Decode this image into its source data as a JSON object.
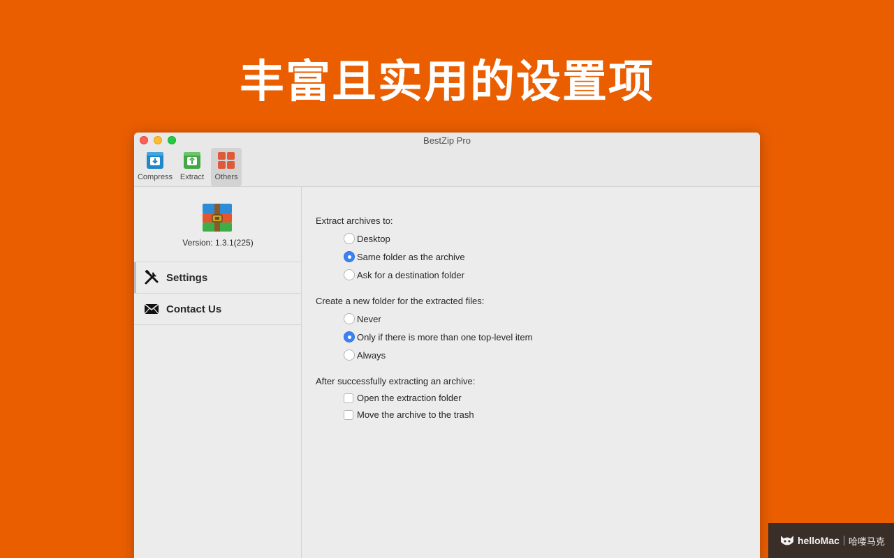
{
  "headline": "丰富且实用的设置项",
  "window": {
    "title": "BestZip Pro"
  },
  "toolbar": {
    "items": [
      {
        "label": "Compress",
        "icon": "compress-box-icon",
        "color": "#1E88C9"
      },
      {
        "label": "Extract",
        "icon": "extract-box-icon",
        "color": "#43A843"
      },
      {
        "label": "Others",
        "icon": "grid-tiles-icon",
        "color": "#E05A3A",
        "active": true
      }
    ]
  },
  "sidebar": {
    "version": "Version: 1.3.1(225)",
    "items": [
      {
        "label": "Settings",
        "icon": "tools-icon",
        "active": true
      },
      {
        "label": "Contact Us",
        "icon": "envelope-icon",
        "active": false
      }
    ]
  },
  "settings": {
    "extract_to": {
      "label": "Extract archives to:",
      "options": [
        "Desktop",
        "Same folder as the archive",
        "Ask for a destination folder"
      ],
      "selected_index": 1
    },
    "new_folder": {
      "label": "Create a new folder for the extracted files:",
      "options": [
        "Never",
        "Only if there is more than one top-level item",
        "Always"
      ],
      "selected_index": 1
    },
    "after_extract": {
      "label": "After successfully extracting an archive:",
      "options": [
        "Open the extraction folder",
        "Move the archive to the trash"
      ],
      "checked": [
        false,
        false
      ]
    }
  },
  "watermark": {
    "brand": "helloMac",
    "cn": "哈喽马克"
  },
  "colors": {
    "background": "#EA5E00",
    "accent": "#3B82F6"
  }
}
